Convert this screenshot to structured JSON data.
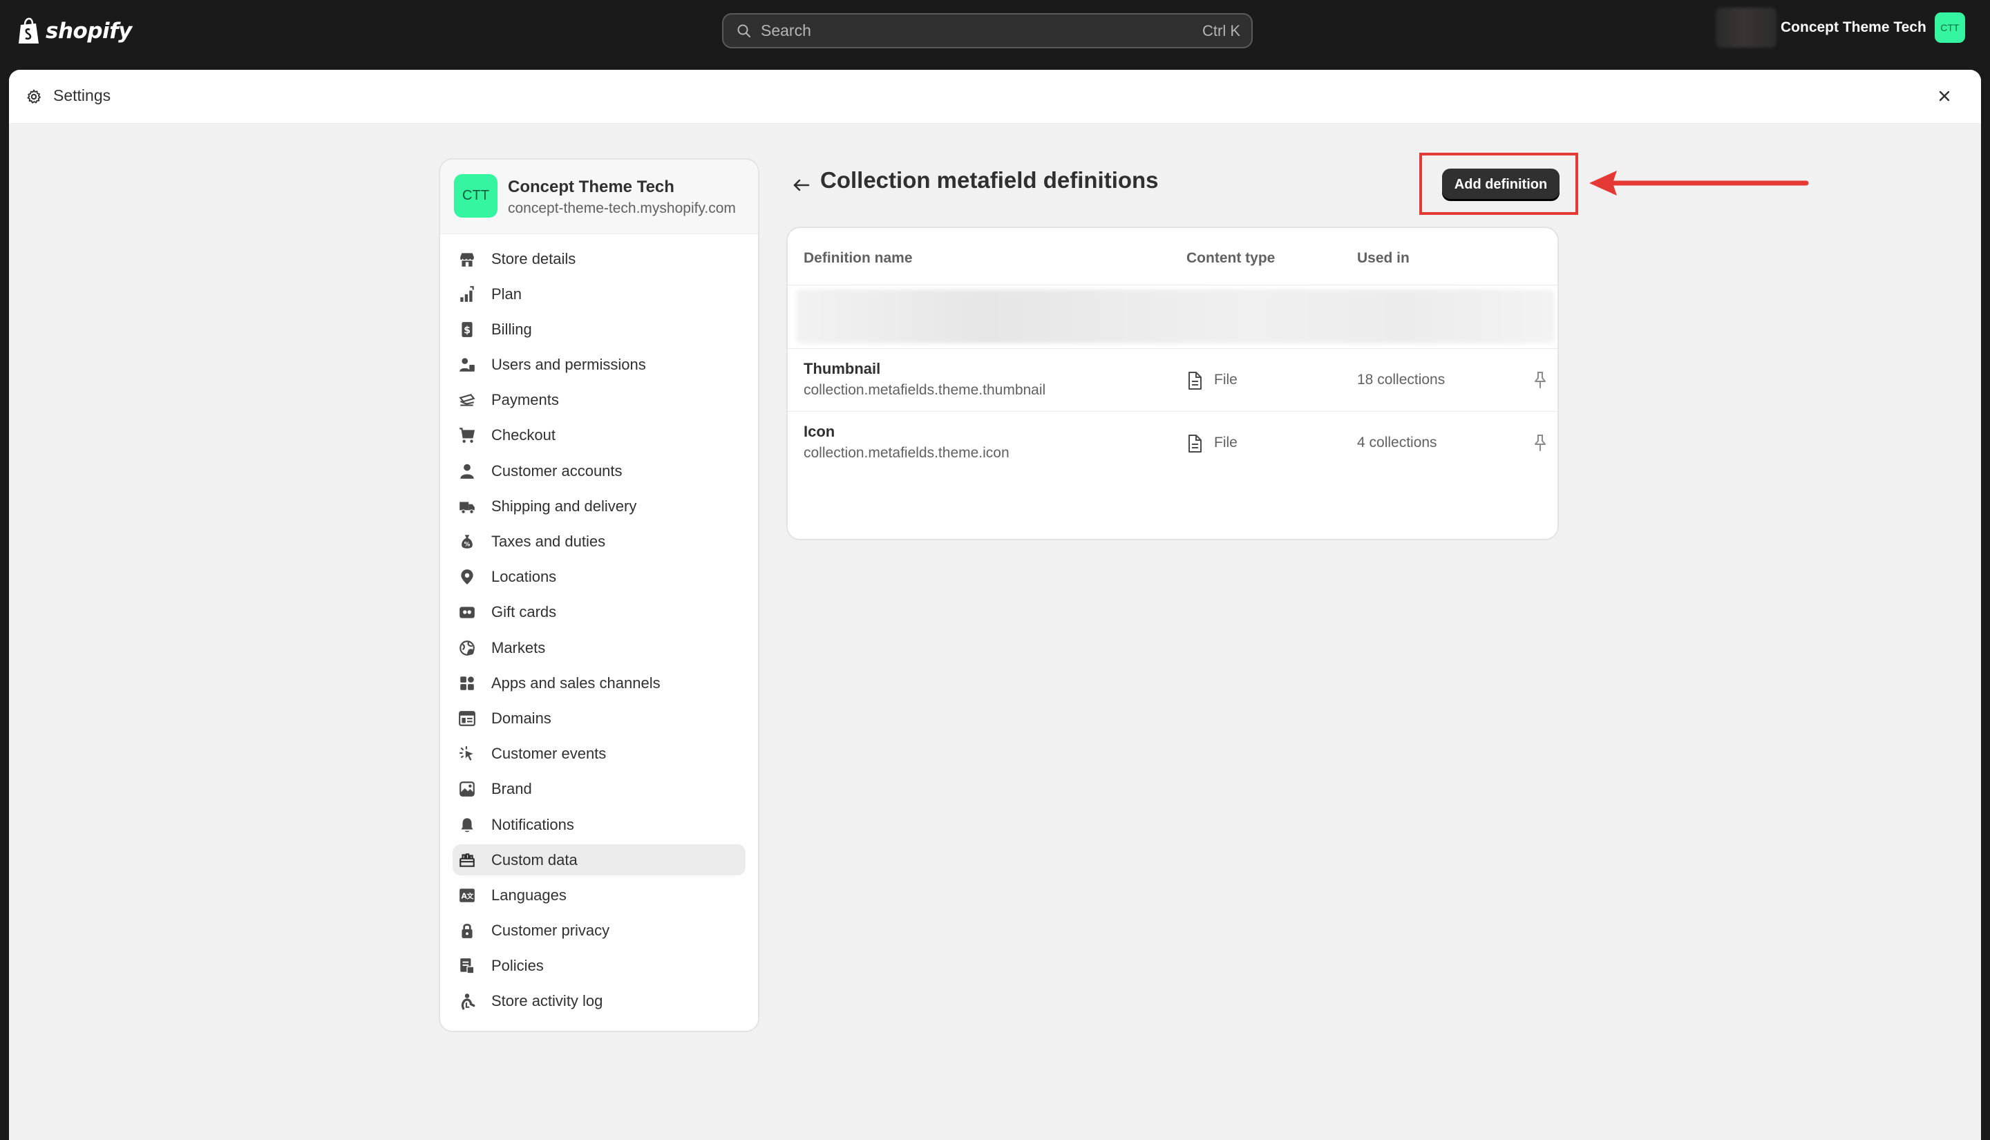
{
  "topbar": {
    "brand": "shopify",
    "search": {
      "placeholder": "Search",
      "shortcut": "Ctrl K"
    },
    "store_name": "Concept Theme Tech",
    "store_initials": "CTT"
  },
  "settings_window": {
    "title": "Settings"
  },
  "sidebar": {
    "shop": {
      "initials": "CTT",
      "name": "Concept Theme Tech",
      "domain": "concept-theme-tech.myshopify.com"
    },
    "items": [
      {
        "label": "Store details",
        "icon": "store-icon"
      },
      {
        "label": "Plan",
        "icon": "plan-icon"
      },
      {
        "label": "Billing",
        "icon": "billing-icon"
      },
      {
        "label": "Users and permissions",
        "icon": "users-icon"
      },
      {
        "label": "Payments",
        "icon": "payments-icon"
      },
      {
        "label": "Checkout",
        "icon": "cart-icon"
      },
      {
        "label": "Customer accounts",
        "icon": "person-icon"
      },
      {
        "label": "Shipping and delivery",
        "icon": "truck-icon"
      },
      {
        "label": "Taxes and duties",
        "icon": "tax-icon"
      },
      {
        "label": "Locations",
        "icon": "location-icon"
      },
      {
        "label": "Gift cards",
        "icon": "gift-card-icon"
      },
      {
        "label": "Markets",
        "icon": "globe-icon"
      },
      {
        "label": "Apps and sales channels",
        "icon": "apps-icon"
      },
      {
        "label": "Domains",
        "icon": "domains-icon"
      },
      {
        "label": "Customer events",
        "icon": "cursor-icon"
      },
      {
        "label": "Brand",
        "icon": "brand-icon"
      },
      {
        "label": "Notifications",
        "icon": "bell-icon"
      },
      {
        "label": "Custom data",
        "icon": "custom-data-icon",
        "active": true
      },
      {
        "label": "Languages",
        "icon": "language-icon"
      },
      {
        "label": "Customer privacy",
        "icon": "lock-icon"
      },
      {
        "label": "Policies",
        "icon": "policies-icon"
      },
      {
        "label": "Store activity log",
        "icon": "activity-icon"
      }
    ]
  },
  "main": {
    "title": "Collection metafield definitions",
    "add_button": "Add definition",
    "table": {
      "columns": [
        "Definition name",
        "Content type",
        "Used in"
      ],
      "rows": [
        {
          "name": "Thumbnail",
          "key": "collection.metafields.theme.thumbnail",
          "content_type": "File",
          "used_in": "18 collections"
        },
        {
          "name": "Icon",
          "key": "collection.metafields.theme.icon",
          "content_type": "File",
          "used_in": "4 collections"
        }
      ]
    }
  },
  "annotation": {
    "highlight_color": "#e53935"
  },
  "colors": {
    "accent_green": "#36f5a0",
    "primary_button": "#303030",
    "topbar": "#1a1a1a"
  }
}
